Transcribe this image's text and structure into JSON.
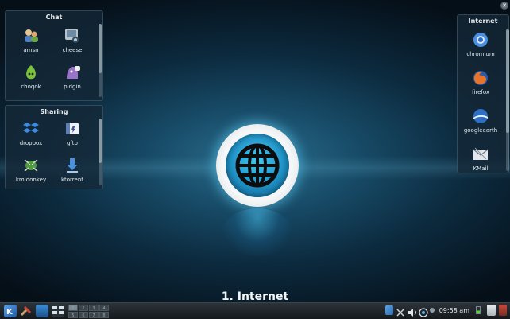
{
  "activity": {
    "title": "1. Internet"
  },
  "panels": {
    "chat": {
      "title": "Chat",
      "items": [
        {
          "label": "amsn",
          "icon": "amsn-icon",
          "color": "#5a8ecb"
        },
        {
          "label": "cheese",
          "icon": "cheese-icon",
          "color": "#8a97a6"
        },
        {
          "label": "choqok",
          "icon": "choqok-icon",
          "color": "#7fc23a"
        },
        {
          "label": "pidgin",
          "icon": "pidgin-icon",
          "color": "#9b6fc8"
        }
      ]
    },
    "sharing": {
      "title": "Sharing",
      "items": [
        {
          "label": "dropbox",
          "icon": "dropbox-icon",
          "color": "#3d8be0"
        },
        {
          "label": "gftp",
          "icon": "gftp-icon",
          "color": "#5e7fb5"
        },
        {
          "label": "kmldonkey",
          "icon": "kmldonkey-icon",
          "color": "#5aa148"
        },
        {
          "label": "ktorrent",
          "icon": "ktorrent-icon",
          "color": "#4a90d9"
        }
      ]
    },
    "internet": {
      "title": "Internet",
      "items": [
        {
          "label": "chromium",
          "icon": "chromium-icon",
          "color": "#4a8fe0"
        },
        {
          "label": "firefox",
          "icon": "firefox-icon",
          "color": "#e8742a"
        },
        {
          "label": "googleearth",
          "icon": "googleearth-icon",
          "color": "#2e6fc4"
        },
        {
          "label": "KMail",
          "icon": "kmail-icon",
          "color": "#d8dde2"
        }
      ]
    }
  },
  "taskbar": {
    "pager": [
      "1",
      "2",
      "3",
      "4",
      "5",
      "6",
      "7",
      "8"
    ],
    "clock": "09:58 am"
  }
}
